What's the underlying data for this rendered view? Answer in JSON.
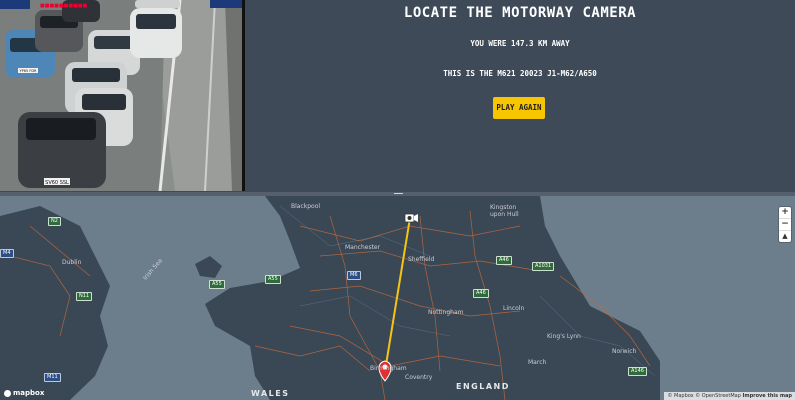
{
  "game": {
    "title": "LOCATE THE MOTORWAY CAMERA",
    "distance_text": "YOU WERE 147.3 KM AWAY",
    "camera_text": "THIS IS THE M621 20023 J1-M62/A650",
    "play_again_label": "PLAY AGAIN"
  },
  "camera_feed": {
    "plate_front": "SV60 SSL",
    "plate_left": "YP65 FDR",
    "stamp_left": "[logo]",
    "stamp_right": "[stamp]"
  },
  "map": {
    "zoom_in": "+",
    "zoom_out": "−",
    "compass": "▲",
    "logo": "mapbox",
    "attribution_text": "© Mapbox © OpenStreetMap",
    "attribution_link": "Improve this map",
    "place_labels": {
      "blackpool": "Blackpool",
      "kingston": "Kingston upon Hull",
      "manchester": "Manchester",
      "sheffield": "Sheffield",
      "dublin": "Dublin",
      "irish_sea": "Irish Sea",
      "nottingham": "Nottingham",
      "lincoln": "Lincoln",
      "kings_lynn": "King's Lynn",
      "norwich": "Norwich",
      "birmingham": "Birmingham",
      "coventry": "Coventry",
      "march": "March",
      "wales": "WALES",
      "england": "ENGLAND"
    },
    "road_shields": {
      "n2": "N2",
      "m4": "M4",
      "n11": "N11",
      "m11": "M11",
      "a55": "A55",
      "a55b": "A55",
      "m6": "M6",
      "a46": "A46",
      "a1031": "A1031",
      "a46b": "A46",
      "a146": "A146"
    },
    "colors": {
      "guess_line": "#f6c511",
      "guess_marker": "#e03131",
      "camera_marker": "#ffffff"
    }
  }
}
